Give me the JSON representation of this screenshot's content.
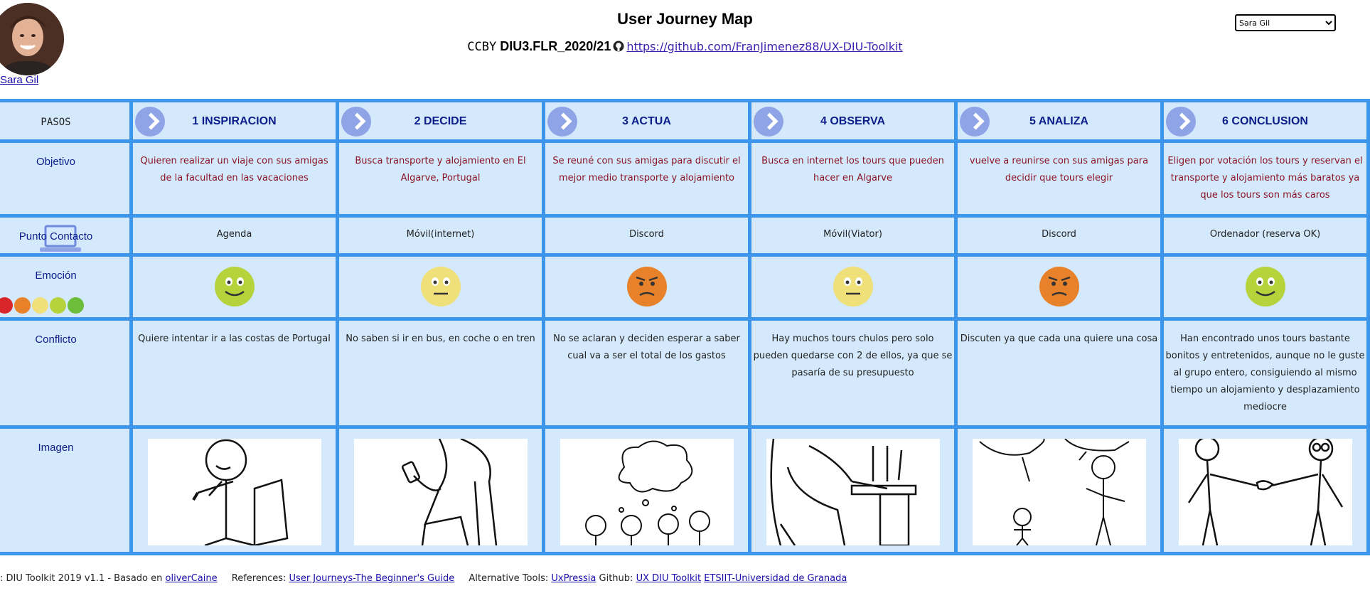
{
  "header": {
    "title": "User Journey Map",
    "cc": "CCBY",
    "course": "DIU3.FLR_2020/21",
    "repo_url": "https://github.com/FranJimenez88/UX-DIU-Toolkit"
  },
  "user": {
    "name": "Sara Gil",
    "selected": "Sara Gil"
  },
  "rows": {
    "steps": "PASOS",
    "objective": "Objetivo",
    "contact": "Punto Contacto",
    "emotion": "Emoción",
    "conflict": "Conflicto",
    "image": "Imagen"
  },
  "steps": [
    {
      "title": "1 INSPIRACION",
      "objective": "Quieren realizar un viaje con sus amigas de la facultad en las vacaciones",
      "contact": "Agenda",
      "emotion": "happy",
      "conflict": "Quiere intentar ir a las costas de Portugal",
      "image": "person-thinking-sketch"
    },
    {
      "title": "2 DECIDE",
      "objective": "Busca transporte y alojamiento en El Algarve, Portugal",
      "contact": "Móvil(internet)",
      "emotion": "neutral",
      "conflict": "No saben si ir en bus, en coche o en tren",
      "image": "person-phone-sketch"
    },
    {
      "title": "3 ACTUA",
      "objective": "Se reuné con sus amigas para discutir el mejor medio transporte y alojamiento",
      "contact": "Discord",
      "emotion": "annoyed",
      "conflict": "No se aclaran y deciden esperar a saber cual va a ser el total de los gastos",
      "image": "group-thinking-sketch"
    },
    {
      "title": "4 OBSERVA",
      "objective": "Busca en internet los tours que pueden hacer en Algarve",
      "contact": "Móvil(Viator)",
      "emotion": "neutral",
      "conflict": "Hay muchos tours chulos pero solo pueden quedarse con 2 de ellos, ya que se pasaría de su presupuesto",
      "image": "person-computer-sketch"
    },
    {
      "title": "5 ANALIZA",
      "objective": "vuelve a reunirse con sus amigas para decidir que tours elegir",
      "contact": "Discord",
      "emotion": "annoyed",
      "conflict": "Discuten ya que cada una quiere una cosa",
      "image": "people-arguing-sketch"
    },
    {
      "title": "6 CONCLUSION",
      "objective": "Eligen por votación los tours y reservan el transporte y alojamiento más baratos ya que los tours son más caros",
      "contact": "Ordenador (reserva OK)",
      "emotion": "happy",
      "conflict": "Han encontrado unos tours bastante bonitos y entretenidos, aunque no le guste al grupo entero, consiguiendo al mismo tiempo un alojamiento y desplazamiento mediocre",
      "image": "handshake-sketch"
    }
  ],
  "emotion_colors": [
    "#d9262b",
    "#e8822a",
    "#f0e07a",
    "#b6d33c",
    "#6cbd3a"
  ],
  "footer": {
    "credit": ": DIU Toolkit 2019 v1.1 - Basado en",
    "credit_link": "oliverCaine",
    "references_label": "References:",
    "references_link": "User Journeys-The Beginner's Guide",
    "alt_label": "Alternative Tools:",
    "alt_link": "UxPressia",
    "github_label": "Github:",
    "github_link": "UX DIU Toolkit",
    "univ_link": "ETSIIT-Universidad de Granada"
  }
}
